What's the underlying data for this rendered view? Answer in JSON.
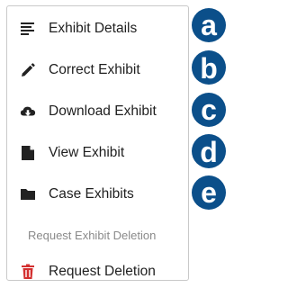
{
  "menu": {
    "items": [
      {
        "label": "Exhibit Details",
        "icon": "details-list-icon"
      },
      {
        "label": "Correct Exhibit",
        "icon": "pencil-icon"
      },
      {
        "label": "Download Exhibit",
        "icon": "cloud-download-icon"
      },
      {
        "label": "View Exhibit",
        "icon": "document-icon"
      },
      {
        "label": "Case Exhibits",
        "icon": "folder-icon"
      }
    ],
    "section_label": "Request Exhibit Deletion",
    "delete_item": {
      "label": "Request Deletion",
      "icon": "trash-icon",
      "icon_color": "#d32f2f"
    }
  },
  "badges": {
    "letters": [
      "a",
      "b",
      "c",
      "d",
      "e"
    ],
    "color": "#0b4f8a"
  }
}
